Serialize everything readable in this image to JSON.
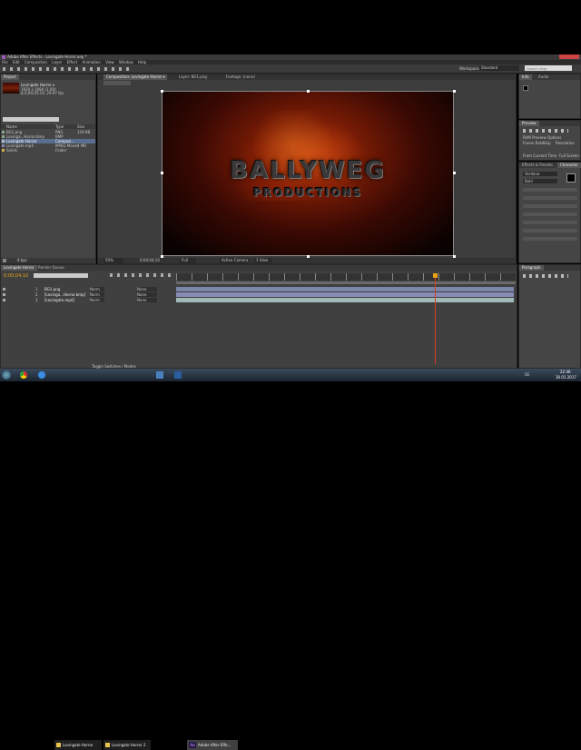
{
  "window": {
    "title": "Adobe After Effects - Lovingate Horror.aep *"
  },
  "menu": [
    "File",
    "Edit",
    "Composition",
    "Layer",
    "Effect",
    "Animation",
    "View",
    "Window",
    "Help"
  ],
  "toolbar": {
    "workspace_label": "Workspace:",
    "workspace_value": "Standard",
    "search_placeholder": "Search Help"
  },
  "project": {
    "tab": "Project",
    "comp_name": "Lovingate Horror ▾",
    "comp_info1": "1920 x 1080 (1.00)",
    "comp_info2": "Δ 0;00;05;10, 29.97 fps",
    "columns": [
      "Name",
      "Type",
      "Size"
    ],
    "items": [
      {
        "name": "BG1.png",
        "type": "PNG",
        "size": "129 KB"
      },
      {
        "name": "Lovinga...Horror.bmp",
        "type": "BMP",
        "size": ""
      },
      {
        "name": "Lovingate Horror",
        "type": "Composi...",
        "size": ""
      },
      {
        "name": "Lovingate.mp4",
        "type": "MPEG Movie",
        "size": "4 MB"
      },
      {
        "name": "Solids",
        "type": "Folder",
        "size": ""
      }
    ],
    "bpc": "8 bpc"
  },
  "comp_viewer": {
    "tabs": [
      "Composition: Lovingate Horror ▾",
      "Layer: BG1.png",
      "Footage: (none)"
    ],
    "title_text": "BALLYWEG",
    "subtitle_text": "PRODUCTIONS",
    "zoom": "50%",
    "timecode": "0;00;04;10",
    "quality": "Full",
    "camera": "Active Camera",
    "views": "1 View"
  },
  "info_panel": {
    "tabs": [
      "Info",
      "Audio"
    ]
  },
  "preview_panel": {
    "tab": "Preview",
    "options_label": "RAM Preview Options",
    "frame_rate_label": "Frame Rate",
    "skip_label": "Skip",
    "resolution_label": "Resolution",
    "from_current": "From Current Time",
    "full_screen": "Full Screen"
  },
  "effects_panel": {
    "tabs": [
      "Effects & Presets",
      "Character"
    ],
    "font": "Verdana",
    "style": "Bold"
  },
  "paragraph_panel": {
    "tab": "Paragraph"
  },
  "timeline": {
    "tabs": [
      "Lovingate Horror",
      "Render Queue"
    ],
    "current_time": "0;00;04;10",
    "layers": [
      {
        "num": "1",
        "name": "BG1.png"
      },
      {
        "num": "2",
        "name": "[Lovinga...Horror.bmp]"
      },
      {
        "num": "3",
        "name": "[Lovingate.mp4]"
      }
    ],
    "mode_label": "Norm",
    "parent_label": "None",
    "toggle_label": "Toggle Switches / Modes"
  },
  "taskbar": {
    "items": [
      "Lovingate Horror",
      "Lovingate Horror 2",
      "Adobe After Effe..."
    ],
    "ae_icon": "Ae",
    "lang": "DE",
    "time": "22:46",
    "date": "30.01.2017"
  },
  "colors": {
    "bg_dark": "#1b1b1b",
    "panel": "#454545",
    "accent": "#e8a317",
    "selection": "#5a6f8f"
  }
}
